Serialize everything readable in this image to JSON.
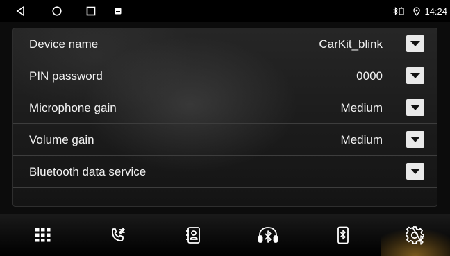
{
  "status_bar": {
    "nav_icons": [
      "back-icon",
      "home-icon",
      "recent-apps-icon",
      "notification-icon"
    ],
    "bluetooth_battery_icon": "bluetooth-battery-icon",
    "location_icon": "location-pin-icon",
    "time": "14:24"
  },
  "settings": {
    "rows": [
      {
        "label": "Device name",
        "value": "CarKit_blink"
      },
      {
        "label": "PIN password",
        "value": "0000"
      },
      {
        "label": "Microphone gain",
        "value": "Medium"
      },
      {
        "label": "Volume gain",
        "value": "Medium"
      },
      {
        "label": "Bluetooth data service",
        "value": ""
      }
    ]
  },
  "dock": {
    "items": [
      {
        "icon": "dialpad-icon",
        "active": false
      },
      {
        "icon": "call-log-icon",
        "active": false
      },
      {
        "icon": "contacts-icon",
        "active": false
      },
      {
        "icon": "bluetooth-music-icon",
        "active": false
      },
      {
        "icon": "bluetooth-device-icon",
        "active": false
      },
      {
        "icon": "bluetooth-settings-icon",
        "active": true
      }
    ]
  },
  "colors": {
    "background": "#0c0c0c",
    "text": "#f2f2f2",
    "dropdown_button": "#e9e9e9",
    "active_glow": "#7a5a1e"
  }
}
